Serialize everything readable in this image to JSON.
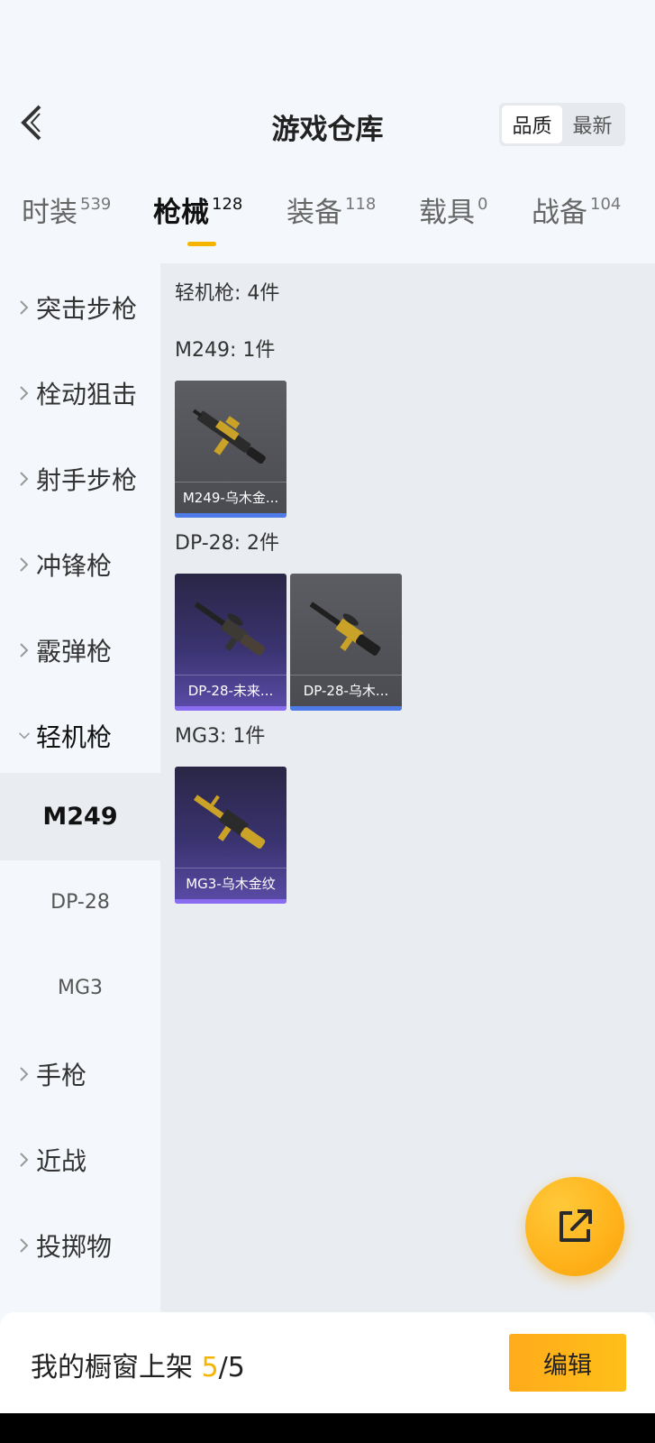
{
  "header": {
    "title": "游戏仓库",
    "sort_options": [
      "品质",
      "最新"
    ],
    "active_sort": "品质"
  },
  "tabs": [
    {
      "label": "时装",
      "count": "539"
    },
    {
      "label": "枪械",
      "count": "128"
    },
    {
      "label": "装备",
      "count": "118"
    },
    {
      "label": "载具",
      "count": "0"
    },
    {
      "label": "战备",
      "count": "104"
    }
  ],
  "active_tab": "枪械",
  "sidebar": {
    "categories": [
      {
        "label": "突击步枪",
        "expanded": false
      },
      {
        "label": "栓动狙击",
        "expanded": false
      },
      {
        "label": "射手步枪",
        "expanded": false
      },
      {
        "label": "冲锋枪",
        "expanded": false
      },
      {
        "label": "霰弹枪",
        "expanded": false
      },
      {
        "label": "轻机枪",
        "expanded": true
      },
      {
        "label": "手枪",
        "expanded": false
      },
      {
        "label": "近战",
        "expanded": false
      },
      {
        "label": "投掷物",
        "expanded": false
      }
    ],
    "subitems": [
      {
        "label": "M249",
        "active": true
      },
      {
        "label": "DP-28",
        "active": false
      },
      {
        "label": "MG3",
        "active": false
      }
    ]
  },
  "content": {
    "category_summary": "轻机枪: 4件",
    "groups": [
      {
        "label": "M249: 1件",
        "items": [
          {
            "name": "M249-乌木金...",
            "rarity": "gray"
          }
        ]
      },
      {
        "label": "DP-28: 2件",
        "items": [
          {
            "name": "DP-28-未来...",
            "rarity": "purple"
          },
          {
            "name": "DP-28-乌木...",
            "rarity": "gray"
          }
        ]
      },
      {
        "label": "MG3: 1件",
        "items": [
          {
            "name": "MG3-乌木金纹",
            "rarity": "purple"
          }
        ]
      }
    ]
  },
  "fab": {
    "icon": "share-external-icon"
  },
  "bottom": {
    "showcase_prefix": "我的橱窗上架 ",
    "showcase_current": "5",
    "showcase_total": "/5",
    "edit_label": "编辑"
  },
  "colors": {
    "accent": "#f5b400",
    "rarity_blue": "#4f7be8",
    "rarity_purple": "#8a6cf0"
  }
}
